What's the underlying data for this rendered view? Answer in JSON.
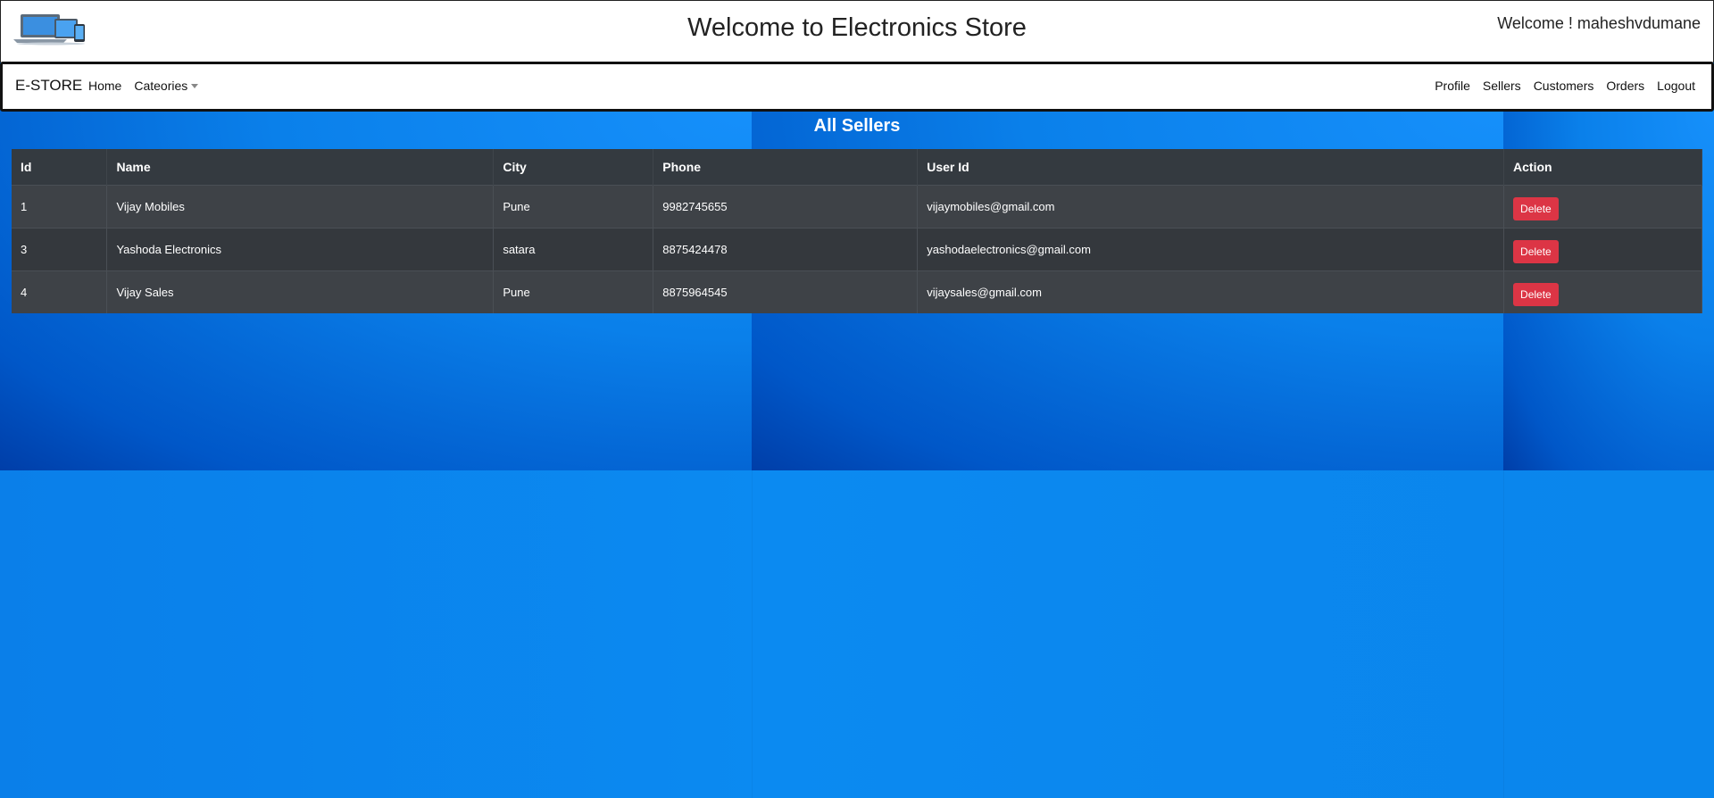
{
  "header": {
    "title": "Welcome to Electronics Store",
    "welcome": "Welcome ! maheshvdumane"
  },
  "navbar": {
    "brand": "E-STORE",
    "left": {
      "home": "Home",
      "categories": "Cateories"
    },
    "right": {
      "profile": "Profile",
      "sellers": "Sellers",
      "customers": "Customers",
      "orders": "Orders",
      "logout": "Logout"
    }
  },
  "page": {
    "heading": "All Sellers"
  },
  "table": {
    "headers": {
      "id": "Id",
      "name": "Name",
      "city": "City",
      "phone": "Phone",
      "user_id": "User Id",
      "action": "Action"
    },
    "rows": [
      {
        "id": "1",
        "name": "Vijay Mobiles",
        "city": "Pune",
        "phone": "9982745655",
        "user_id": "vijaymobiles@gmail.com",
        "action": "Delete"
      },
      {
        "id": "3",
        "name": "Yashoda Electronics",
        "city": "satara",
        "phone": "8875424478",
        "user_id": "yashodaelectronics@gmail.com",
        "action": "Delete"
      },
      {
        "id": "4",
        "name": "Vijay Sales",
        "city": "Pune",
        "phone": "8875964545",
        "user_id": "vijaysales@gmail.com",
        "action": "Delete"
      }
    ]
  },
  "colors": {
    "background": "#0a86ec",
    "table_header": "#343a40",
    "delete_button": "#dc3545"
  },
  "icons": {
    "logo": "laptop-devices-logo"
  }
}
